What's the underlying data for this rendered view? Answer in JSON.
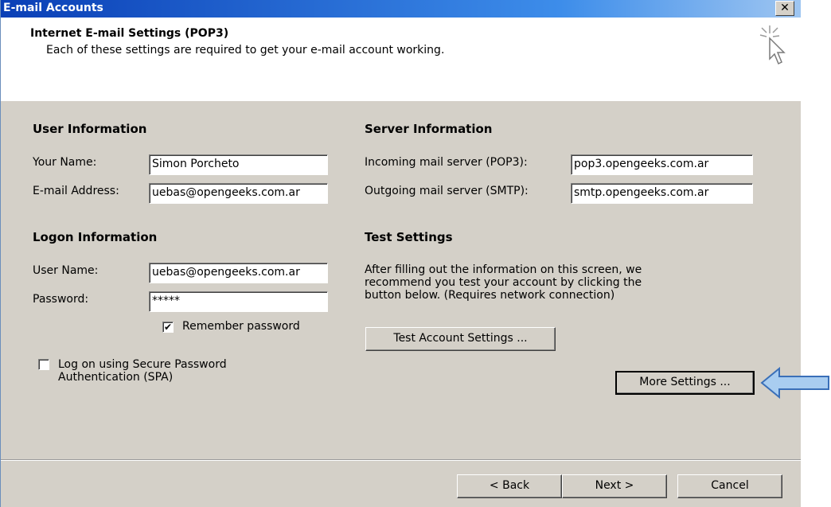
{
  "window": {
    "title": "E-mail Accounts",
    "close_glyph": "✕"
  },
  "header": {
    "title": "Internet E-mail Settings (POP3)",
    "subtitle": "Each of these settings are required to get your e-mail account working."
  },
  "user_info": {
    "heading": "User Information",
    "name_label": "Your Name:",
    "name_value": "Simon Porcheto",
    "email_label": "E-mail Address:",
    "email_value": "uebas@opengeeks.com.ar"
  },
  "server_info": {
    "heading": "Server Information",
    "incoming_label": "Incoming mail server (POP3):",
    "incoming_value": "pop3.opengeeks.com.ar",
    "outgoing_label": "Outgoing mail server (SMTP):",
    "outgoing_value": "smtp.opengeeks.com.ar"
  },
  "logon_info": {
    "heading": "Logon Information",
    "user_label": "User Name:",
    "user_value": "uebas@opengeeks.com.ar",
    "password_label": "Password:",
    "password_value": "*****",
    "remember_label": "Remember password",
    "remember_checked": true,
    "spa_label_line1": "Log on using Secure Password",
    "spa_label_line2": "Authentication (SPA)",
    "spa_checked": false
  },
  "test_settings": {
    "heading": "Test Settings",
    "line1": "After filling out the information on this screen, we",
    "line2": "recommend you test your account by clicking the",
    "line3": "button below. (Requires network connection)",
    "test_button": "Test Account Settings ..."
  },
  "more_settings_button": "More Settings ...",
  "footer": {
    "back": "< Back",
    "next": "Next >",
    "cancel": "Cancel"
  },
  "colors": {
    "titlebar": "#0a3fb6",
    "dialog_bg": "#d4d0c8",
    "arrow_fill": "#a9cdf0",
    "arrow_stroke": "#3a6fb8"
  },
  "icons": {
    "wizard": "cursor-sparkle-icon",
    "pointer": "blue-arrow-icon"
  }
}
